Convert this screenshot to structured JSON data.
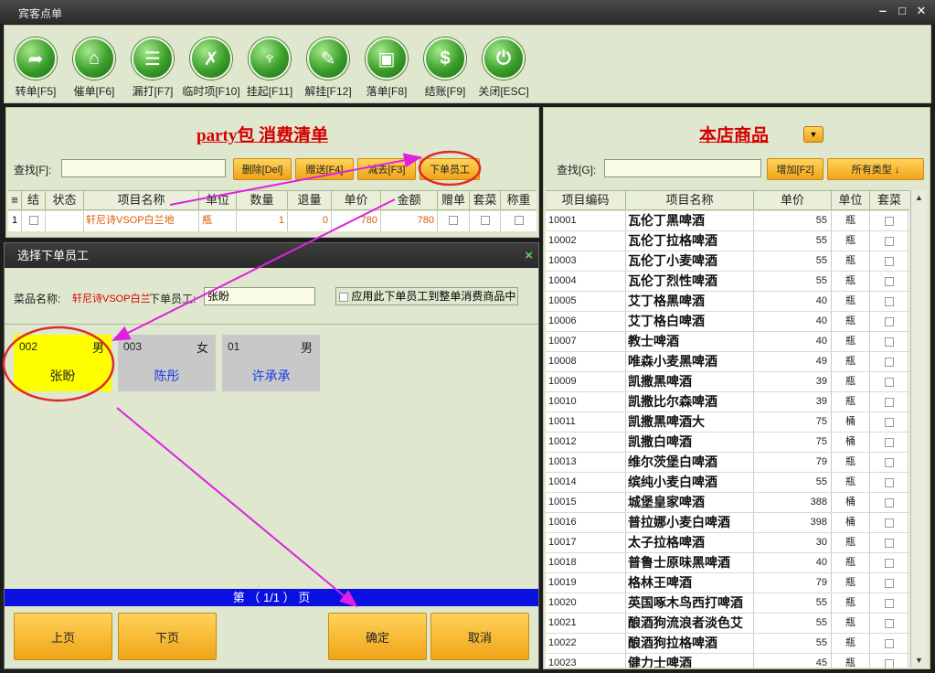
{
  "window": {
    "title": "宾客点单",
    "min": "‒",
    "max": "□",
    "close": "✕"
  },
  "toolbar": [
    {
      "label": "转单[F5]",
      "icon": "transfer-icon",
      "glyph": "➦"
    },
    {
      "label": "催单[F6]",
      "icon": "building-icon",
      "glyph": "⌂"
    },
    {
      "label": "漏打[F7]",
      "icon": "document-icon",
      "glyph": "☰"
    },
    {
      "label": "临时项[F10]",
      "icon": "utensils-icon",
      "glyph": "✗"
    },
    {
      "label": "挂起[F11]",
      "icon": "tie-icon",
      "glyph": "♆"
    },
    {
      "label": "解挂[F12]",
      "icon": "pen-icon",
      "glyph": "✎"
    },
    {
      "label": "落单[F8]",
      "icon": "monitor-icon",
      "glyph": "▣"
    },
    {
      "label": "结账[F9]",
      "icon": "dollar-icon",
      "glyph": "$"
    },
    {
      "label": "关闭[ESC]",
      "icon": "power-icon",
      "glyph": "⏻"
    }
  ],
  "bill": {
    "title": "party包  消费清单",
    "search_label": "查找[F]:",
    "buttons": [
      "删除[Del]",
      "赠送[F4]",
      "减去[F3]",
      "下单员工"
    ],
    "columns": [
      "≡",
      "结",
      "状态",
      "项目名称",
      "单位",
      "数量",
      "退量",
      "单价",
      "金额",
      "赠单",
      "套菜",
      "称重"
    ],
    "rows": [
      {
        "idx": "1",
        "name": "轩尼诗VSOP白兰地",
        "unit": "瓶",
        "qty": "1",
        "ret": "0",
        "price": "780",
        "amount": "780"
      }
    ]
  },
  "dialog": {
    "title": "选择下单员工",
    "close": "×",
    "dish_label": "菜品名称:",
    "dish_value": "轩尼诗VSOP白兰",
    "staff_label": "下单员工:",
    "staff_value": "张盼",
    "apply_label": "应用此下单员工到整单消费商品中",
    "employees": [
      {
        "id": "002",
        "sex": "男",
        "name": "张盼",
        "selected": true
      },
      {
        "id": "003",
        "sex": "女",
        "name": "陈彤",
        "selected": false
      },
      {
        "id": "01",
        "sex": "男",
        "name": "许承承",
        "selected": false
      }
    ],
    "page_text": "第  （  1/1  ）  页",
    "btn_prev": "上页",
    "btn_next": "下页",
    "btn_ok": "确定",
    "btn_cancel": "取消"
  },
  "store": {
    "title": "本店商品",
    "search_label": "查找[G]:",
    "add_btn": "增加[F2]",
    "type_btn": "所有类型 ↓",
    "columns": [
      "项目编码",
      "项目名称",
      "单价",
      "单位",
      "套菜"
    ],
    "rows": [
      [
        "10001",
        "瓦伦丁黑啤酒",
        "55",
        "瓶"
      ],
      [
        "10002",
        "瓦伦丁拉格啤酒",
        "55",
        "瓶"
      ],
      [
        "10003",
        "瓦伦丁小麦啤酒",
        "55",
        "瓶"
      ],
      [
        "10004",
        "瓦伦丁烈性啤酒",
        "55",
        "瓶"
      ],
      [
        "10005",
        "艾丁格黑啤酒",
        "40",
        "瓶"
      ],
      [
        "10006",
        "艾丁格白啤酒",
        "40",
        "瓶"
      ],
      [
        "10007",
        "教士啤酒",
        "40",
        "瓶"
      ],
      [
        "10008",
        "唯森小麦黑啤酒",
        "49",
        "瓶"
      ],
      [
        "10009",
        "凯撒黑啤酒",
        "39",
        "瓶"
      ],
      [
        "10010",
        "凯撒比尔森啤酒",
        "39",
        "瓶"
      ],
      [
        "10011",
        "凯撒黑啤酒大",
        "75",
        "桶"
      ],
      [
        "10012",
        "凯撒白啤酒",
        "75",
        "桶"
      ],
      [
        "10013",
        "维尔茨堡白啤酒",
        "79",
        "瓶"
      ],
      [
        "10014",
        "缤纯小麦白啤酒",
        "55",
        "瓶"
      ],
      [
        "10015",
        "城堡皇家啤酒",
        "388",
        "桶"
      ],
      [
        "10016",
        "普拉娜小麦白啤酒",
        "398",
        "桶"
      ],
      [
        "10017",
        "太子拉格啤酒",
        "30",
        "瓶"
      ],
      [
        "10018",
        "普鲁士原味黑啤酒",
        "40",
        "瓶"
      ],
      [
        "10019",
        "格林王啤酒",
        "79",
        "瓶"
      ],
      [
        "10020",
        "英国啄木鸟西打啤酒",
        "55",
        "瓶"
      ],
      [
        "10021",
        "酿酒狗流浪者淡色艾",
        "55",
        "瓶"
      ],
      [
        "10022",
        "酿酒狗拉格啤酒",
        "55",
        "瓶"
      ],
      [
        "10023",
        "健力士啤酒",
        "45",
        "瓶"
      ]
    ]
  },
  "colors": {
    "accent_red": "#d40000",
    "highlight_circle": "#e02a2a",
    "arrow": "#e020e0",
    "selected_emp": "#ffff00",
    "page_bar": "#0a10e0"
  }
}
